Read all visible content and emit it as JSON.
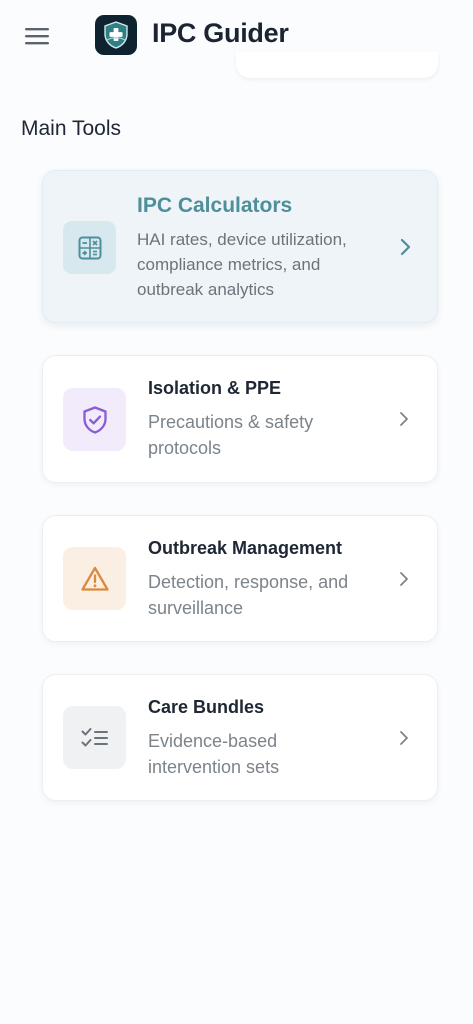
{
  "header": {
    "title": "IPC Guider",
    "menu_icon": "hamburger-menu-icon",
    "logo_icon": "shield-medical-icon"
  },
  "main_tools": {
    "heading": "Main Tools",
    "items": [
      {
        "title": "IPC Calculators",
        "description_lines": [
          "HAI rates, device utilization,",
          "compliance metrics, and",
          "outbreak analytics"
        ],
        "icon": "calculator-icon",
        "accent": "#4e8f9a",
        "tile_bg": "#d8e8ef"
      },
      {
        "title": "Isolation & PPE",
        "description_lines": [
          "Precautions & safety",
          "protocols"
        ],
        "icon": "shield-check-icon",
        "accent": "#8a5cd6",
        "tile_bg": "#f1ebfb"
      },
      {
        "title": "Outbreak Management",
        "description_lines": [
          "Detection, response, and",
          "surveillance"
        ],
        "icon": "warning-triangle-icon",
        "accent": "#d98a3c",
        "tile_bg": "#fbeee2"
      },
      {
        "title": "Care Bundles",
        "description_lines": [
          "Evidence-based",
          "intervention sets"
        ],
        "icon": "checklist-icon",
        "accent": "#6b737b",
        "tile_bg": "#f0f1f3"
      }
    ]
  }
}
